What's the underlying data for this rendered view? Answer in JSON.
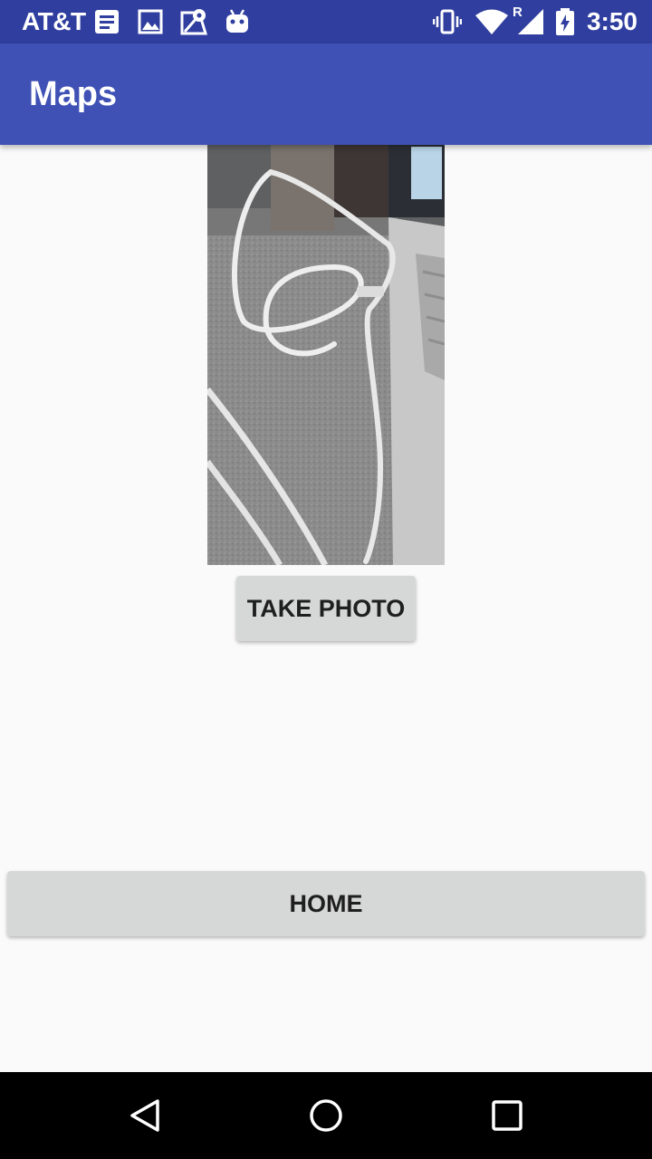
{
  "status_bar": {
    "carrier": "AT&T",
    "time": "3:50",
    "left_icons": [
      "notes-icon",
      "image-icon",
      "maps-icon",
      "android-icon"
    ],
    "right_icons": [
      "vibrate-icon",
      "wifi-icon",
      "signal-roaming-icon",
      "battery-charging-icon"
    ],
    "roaming_indicator": "R"
  },
  "app_bar": {
    "title": "Maps",
    "color": "#3f51b5"
  },
  "photo": {
    "description_icon": "captured-photo"
  },
  "buttons": {
    "take_photo": "TAKE PHOTO",
    "home": "HOME"
  },
  "nav_bar": {
    "icons": [
      "back-icon",
      "home-icon",
      "recents-icon"
    ]
  },
  "colors": {
    "status_bar": "#303f9f",
    "primary": "#3f51b5",
    "background": "#fafafa",
    "button": "#d6d7d7"
  }
}
